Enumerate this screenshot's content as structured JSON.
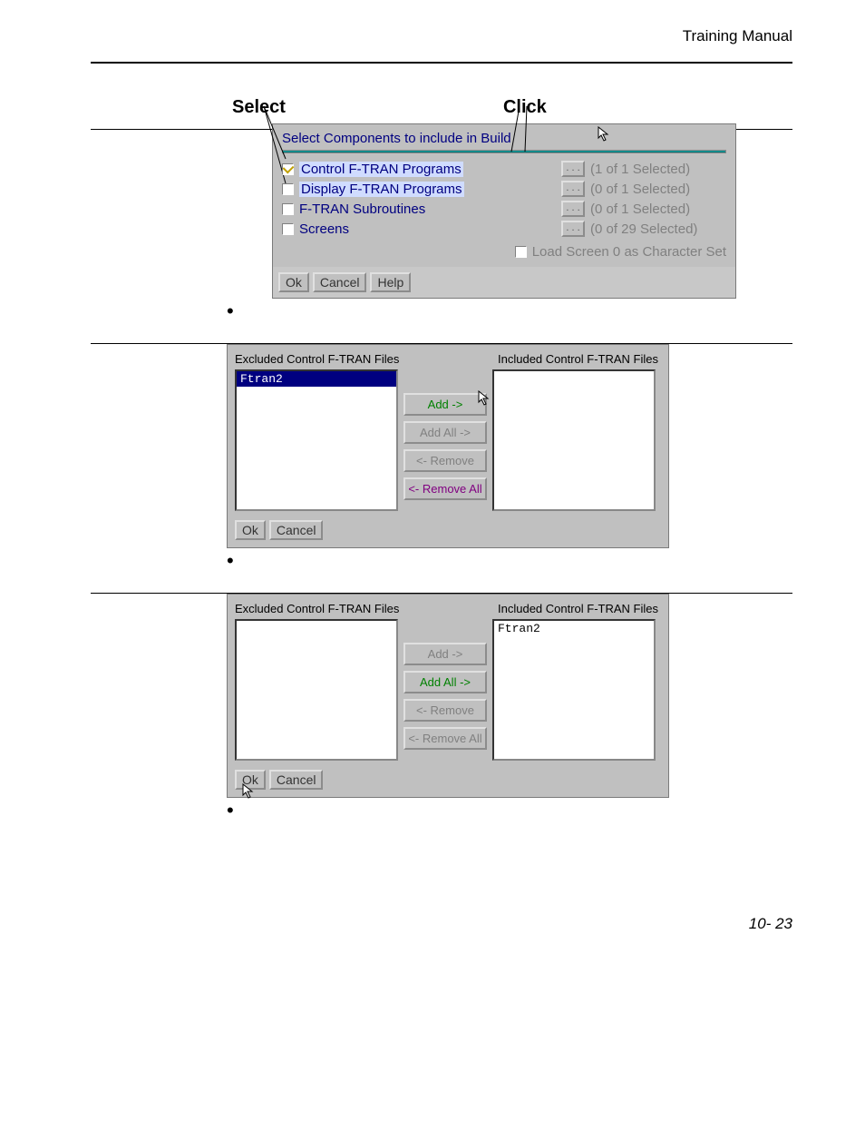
{
  "header": "Training Manual",
  "footer": "10- 23",
  "dlg1": {
    "label_select": "Select",
    "label_click": "Click",
    "title": "Select Components to include in Build",
    "rows": [
      {
        "label": "Control F-TRAN Programs",
        "status": "(1 of 1 Selected)",
        "checked": true,
        "highlight": true
      },
      {
        "label": "Display F-TRAN Programs",
        "status": "(0 of 1 Selected)",
        "checked": false,
        "highlight": true
      },
      {
        "label": "F-TRAN Subroutines",
        "status": "(0 of 1 Selected)",
        "checked": false,
        "highlight": false
      },
      {
        "label": "Screens",
        "status": "(0 of 29 Selected)",
        "checked": false,
        "highlight": false
      }
    ],
    "load_label": "Load Screen 0 as Character Set",
    "ellipsis": ". . .",
    "ok": "Ok",
    "cancel": "Cancel",
    "help": "Help"
  },
  "dlg2": {
    "excluded_hdr": "Excluded Control F-TRAN Files",
    "included_hdr": "Included Control F-TRAN Files",
    "item": "Ftran2",
    "btn_add": "Add ->",
    "btn_addall": "Add All ->",
    "btn_remove": "<- Remove",
    "btn_removeall": "<- Remove All",
    "ok": "Ok",
    "cancel": "Cancel"
  }
}
